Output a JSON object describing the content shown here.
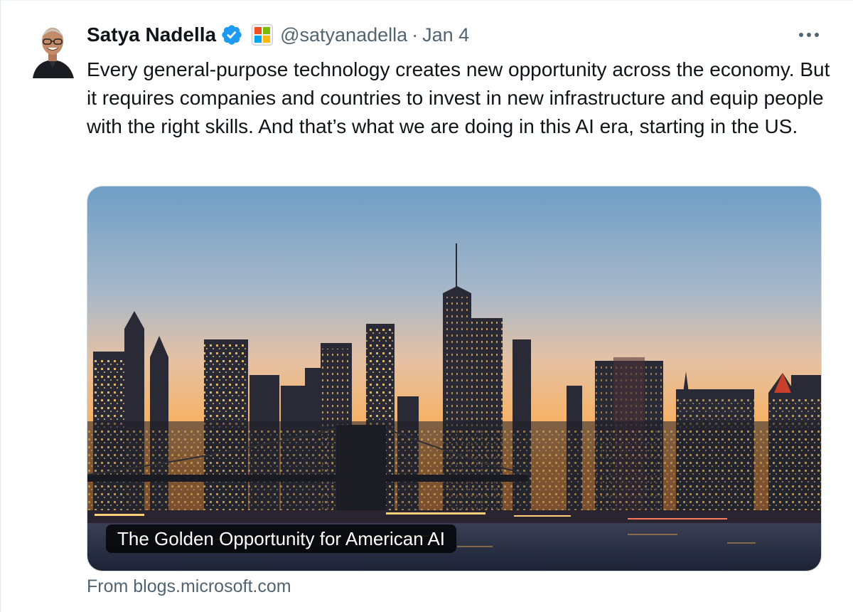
{
  "tweet": {
    "author_name": "Satya Nadella",
    "handle": "@satyanadella",
    "separator": "·",
    "date": "Jan 4",
    "text": "Every general-purpose technology creates new opportunity across the economy. But it requires companies and countries to invest in new infrastructure and equip people with the right skills. And that’s what we are doing in this AI era, starting in the US.",
    "verified": true,
    "icons": {
      "avatar": "profile-photo",
      "verified": "verified-badge-icon",
      "affiliate": "microsoft-logo-icon",
      "more": "more-options-icon"
    }
  },
  "link_card": {
    "title": "The Golden Opportunity for American AI",
    "source": "From blogs.microsoft.com",
    "image": "city-skyline-at-dusk"
  },
  "colors": {
    "text_primary": "#0f1419",
    "text_secondary": "#536471",
    "verified_blue": "#1d9bf0",
    "card_border": "#cfd9de"
  }
}
